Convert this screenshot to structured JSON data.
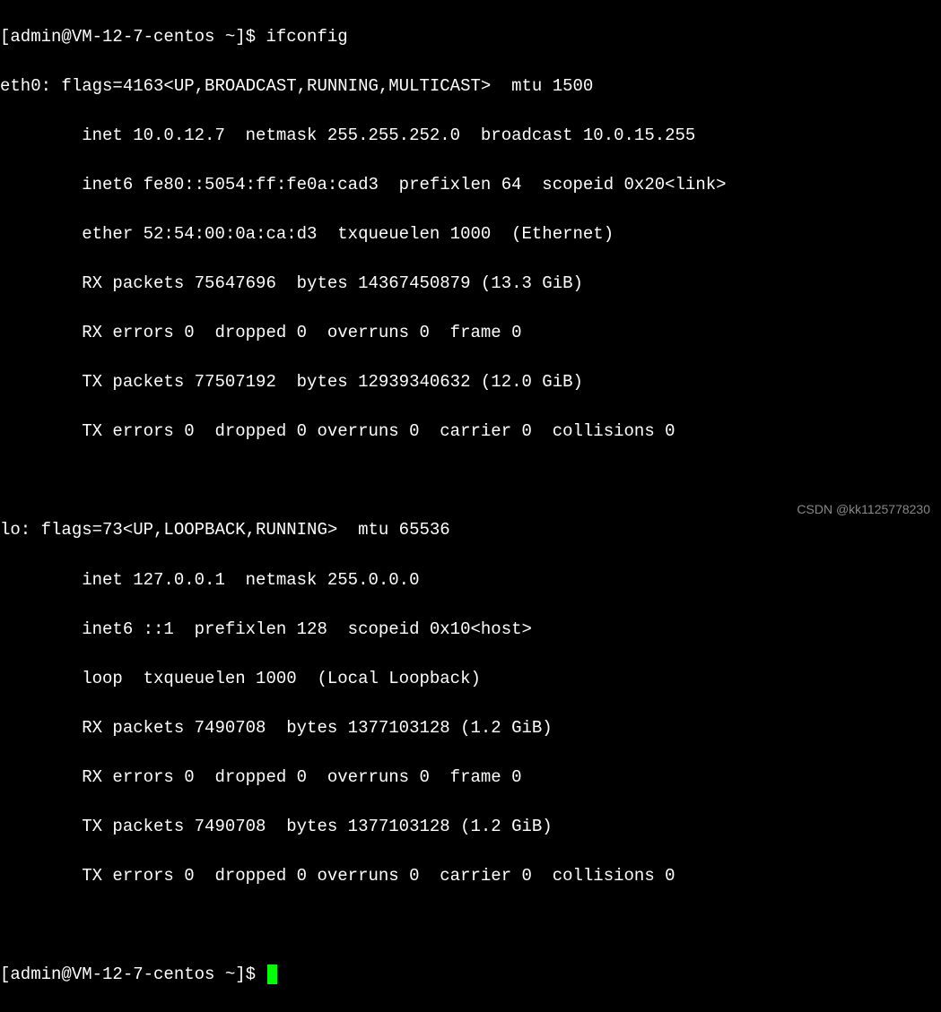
{
  "prompt1": {
    "user": "[admin@VM-12-7-centos ~]$ ",
    "command": "ifconfig"
  },
  "eth0": {
    "header": "eth0: flags=4163<UP,BROADCAST,RUNNING,MULTICAST>  mtu 1500",
    "inet": "        inet 10.0.12.7  netmask 255.255.252.0  broadcast 10.0.15.255",
    "inet6": "        inet6 fe80::5054:ff:fe0a:cad3  prefixlen 64  scopeid 0x20<link>",
    "ether": "        ether 52:54:00:0a:ca:d3  txqueuelen 1000  (Ethernet)",
    "rxp": "        RX packets 75647696  bytes 14367450879 (13.3 GiB)",
    "rxe": "        RX errors 0  dropped 0  overruns 0  frame 0",
    "txp": "        TX packets 77507192  bytes 12939340632 (12.0 GiB)",
    "txe": "        TX errors 0  dropped 0 overruns 0  carrier 0  collisions 0"
  },
  "blank1": " ",
  "lo": {
    "header": "lo: flags=73<UP,LOOPBACK,RUNNING>  mtu 65536",
    "inet": "        inet 127.0.0.1  netmask 255.0.0.0",
    "inet6": "        inet6 ::1  prefixlen 128  scopeid 0x10<host>",
    "loop": "        loop  txqueuelen 1000  (Local Loopback)",
    "rxp": "        RX packets 7490708  bytes 1377103128 (1.2 GiB)",
    "rxe": "        RX errors 0  dropped 0  overruns 0  frame 0",
    "txp": "        TX packets 7490708  bytes 1377103128 (1.2 GiB)",
    "txe": "        TX errors 0  dropped 0 overruns 0  carrier 0  collisions 0"
  },
  "blank2": " ",
  "prompt2": {
    "user": "[admin@VM-12-7-centos ~]$ "
  },
  "watermark": "CSDN @kk1125778230"
}
